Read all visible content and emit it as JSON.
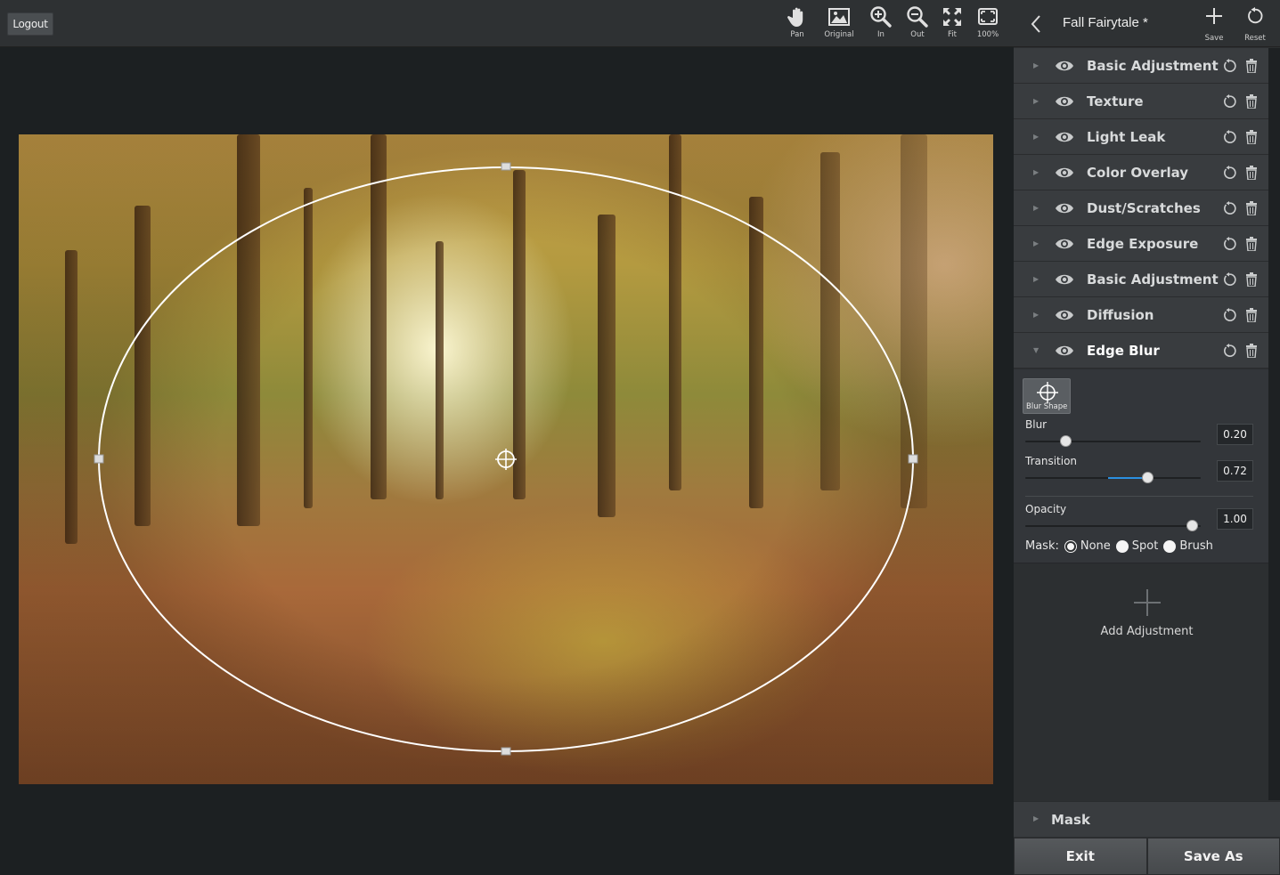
{
  "topbar": {
    "logout_label": "Logout",
    "tools": [
      {
        "label": "Pan",
        "icon": "hand-icon"
      },
      {
        "label": "Original",
        "icon": "image-icon"
      },
      {
        "label": "In",
        "icon": "zoom-in-icon"
      },
      {
        "label": "Out",
        "icon": "zoom-out-icon"
      },
      {
        "label": "Fit",
        "icon": "fit-icon"
      },
      {
        "label": "100%",
        "icon": "actual-size-icon"
      }
    ]
  },
  "panel": {
    "title": "Fall Fairytale *",
    "save_label": "Save",
    "reset_label": "Reset",
    "layers": [
      {
        "name": "Basic Adjustment"
      },
      {
        "name": "Texture"
      },
      {
        "name": "Light Leak"
      },
      {
        "name": "Color Overlay"
      },
      {
        "name": "Dust/Scratches"
      },
      {
        "name": "Edge Exposure"
      },
      {
        "name": "Basic Adjustment"
      },
      {
        "name": "Diffusion"
      },
      {
        "name": "Edge Blur"
      }
    ],
    "settings": {
      "shape_label": "Blur Shape",
      "blur_label": "Blur",
      "blur_value": "0.20",
      "transition_label": "Transition",
      "transition_value": "0.72",
      "opacity_label": "Opacity",
      "opacity_value": "1.00",
      "mask_label": "Mask:",
      "mask_options": [
        "None",
        "Spot",
        "Brush"
      ],
      "mask_selected": "None"
    },
    "add_adjustment_label": "Add Adjustment",
    "mask_section_label": "Mask",
    "exit_label": "Exit",
    "save_as_label": "Save As"
  },
  "colors": {
    "accent": "#2a8fe0",
    "panel_bg": "#2c2f31",
    "canvas_bg": "#1c2022"
  }
}
